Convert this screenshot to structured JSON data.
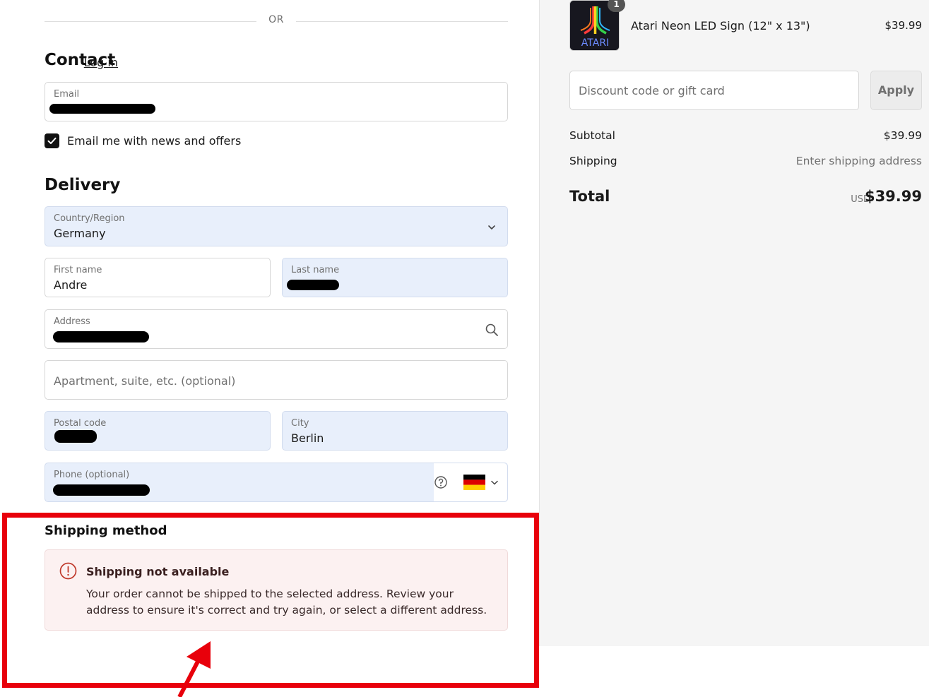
{
  "divider": {
    "or_label": "OR"
  },
  "contact": {
    "title": "Contact",
    "login_link": "Log in",
    "email_label": "Email",
    "newsletter_label": "Email me with news and offers",
    "newsletter_checked": true
  },
  "delivery": {
    "title": "Delivery",
    "country_label": "Country/Region",
    "country_value": "Germany",
    "first_name_label": "First name",
    "first_name_value": "Andre",
    "last_name_label": "Last name",
    "address_label": "Address",
    "apartment_placeholder": "Apartment, suite, etc. (optional)",
    "postal_label": "Postal code",
    "city_label": "City",
    "city_value": "Berlin",
    "phone_label": "Phone (optional)",
    "phone_flag": "germany-flag-icon"
  },
  "shipping": {
    "title": "Shipping method",
    "alert_title": "Shipping not available",
    "alert_body": "Your order cannot be shipped to the selected address. Review your address to ensure it's correct and try again, or select a different address."
  },
  "summary": {
    "product": {
      "name": "Atari Neon LED Sign (12\" x 13\")",
      "price": "$39.99",
      "quantity": "1",
      "thumb_text": "ATARI"
    },
    "discount_placeholder": "Discount code or gift card",
    "apply_label": "Apply",
    "subtotal_label": "Subtotal",
    "subtotal_value": "$39.99",
    "shipping_label": "Shipping",
    "shipping_value": "Enter shipping address",
    "total_label": "Total",
    "total_currency": "USD",
    "total_value": "$39.99"
  },
  "colors": {
    "highlight": "#e8000b",
    "field_autofill": "#e8effb",
    "alert_bg": "#fcf1f1",
    "alert_icon": "#c0392b"
  }
}
